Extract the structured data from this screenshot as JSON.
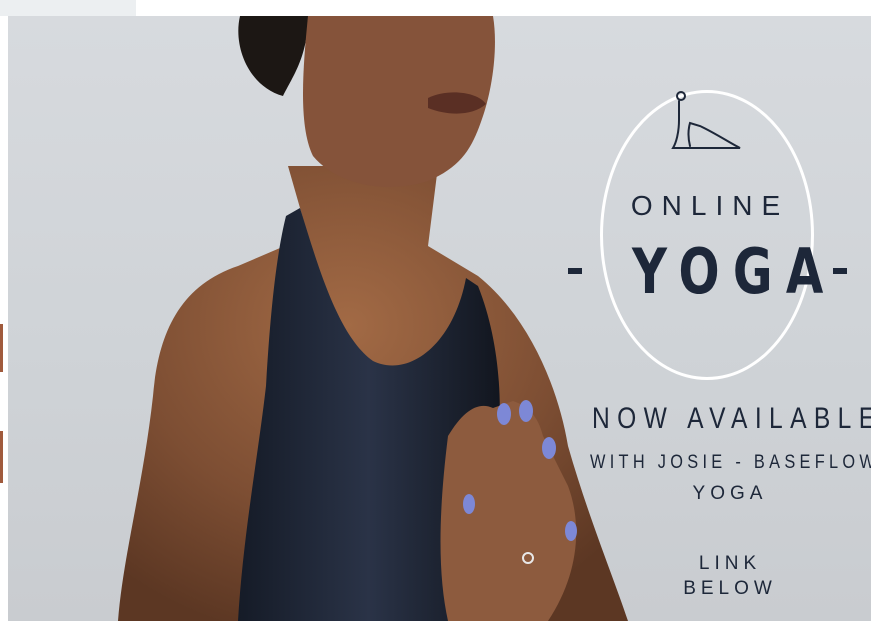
{
  "promo": {
    "heading_small": "ONLINE",
    "heading_large": "YOGA",
    "availability": "NOW AVAILABLE",
    "instructor_line": "WITH JOSIE - BASEFLOW",
    "instructor_line_2": "YOGA",
    "cta_line_1": "LINK",
    "cta_line_2": "BELOW"
  },
  "icons": {
    "pose": "yoga-pose-icon"
  },
  "colors": {
    "text": "#1d2739",
    "background": "#d3d6da",
    "circle": "#ffffff",
    "skin": "#8a5a3c",
    "top": "#1e2433",
    "nails": "#7d88d6"
  }
}
